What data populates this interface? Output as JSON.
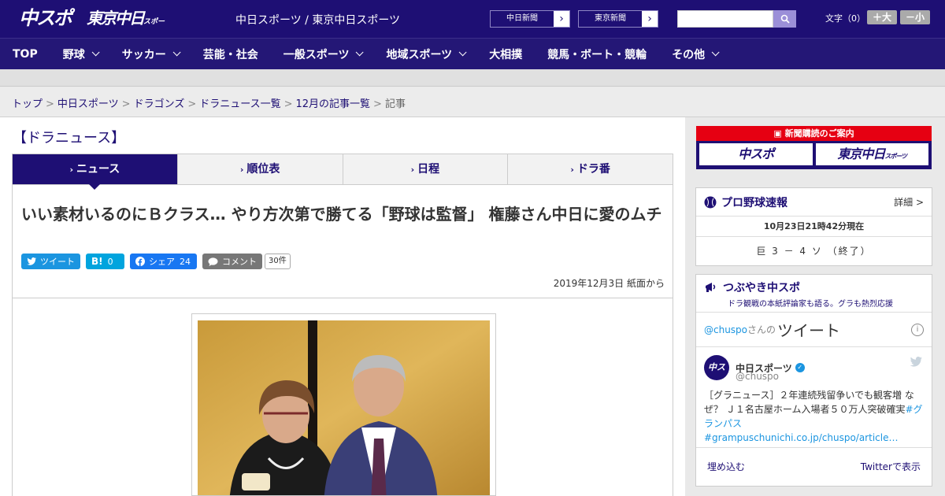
{
  "header": {
    "logo_chuspo": "中スポ",
    "logo_tokyo": "東京中日",
    "logo_tokyo_sub": "スポーツ",
    "site_title": "中日スポーツ / 東京中日スポーツ",
    "paper_buttons": [
      "中日新聞",
      "東京新聞"
    ],
    "search_placeholder": "",
    "font_size_label": "文字（0）",
    "font_large": "＋大",
    "font_small": "－小"
  },
  "nav": {
    "items": [
      {
        "label": "TOP",
        "caret": false
      },
      {
        "label": "野球",
        "caret": true
      },
      {
        "label": "サッカー",
        "caret": true
      },
      {
        "label": "芸能・社会",
        "caret": false
      },
      {
        "label": "一般スポーツ",
        "caret": true
      },
      {
        "label": "地域スポーツ",
        "caret": true
      },
      {
        "label": "大相撲",
        "caret": false
      },
      {
        "label": "競馬・ボート・競輪",
        "caret": false
      },
      {
        "label": "その他",
        "caret": true
      }
    ]
  },
  "breadcrumb": {
    "links": [
      "トップ",
      "中日スポーツ",
      "ドラゴンズ",
      "ドラニュース一覧",
      "12月の記事一覧"
    ],
    "current": "記事",
    "separator": ">"
  },
  "section": {
    "title": "【ドラニュース】"
  },
  "tabs": [
    {
      "label": "ニュース",
      "active": true
    },
    {
      "label": "順位表",
      "active": false
    },
    {
      "label": "日程",
      "active": false
    },
    {
      "label": "ドラ番",
      "active": false
    }
  ],
  "tab_arrow": "›",
  "article": {
    "headline": "いい素材いるのにＢクラス… やり方次第で勝てる「野球は監督」 権藤さん中日に愛のムチ",
    "share": {
      "tweet": "ツイート",
      "hatena_label": "B!",
      "hatena_count": "0",
      "facebook": "シェア",
      "facebook_count": "24",
      "comment": "コメント",
      "comment_count": "30件"
    },
    "dateline": "2019年12月3日 紙面から"
  },
  "sidebar": {
    "ad": {
      "header": "新聞購読のご案内",
      "logos": [
        "中スポ",
        "東京中日"
      ],
      "logo_sub": "スポーツ"
    },
    "score": {
      "title": "プロ野球速報",
      "detail": "詳細 >",
      "timestamp": "10月23日21時42分現在",
      "line": "巨 3 － 4 ソ （終了）"
    },
    "tweets": {
      "title": "つぶやき中スポ",
      "subtitle": "ドラ観戦の本紙評論家も語る。グラも熱烈応援",
      "handle": "@chuspo",
      "handle_suffix": "さんの",
      "word": "ツイート",
      "info": "i",
      "user_name": "中日スポーツ",
      "avatar_text": "中スポ",
      "verified": "✓",
      "user_at": "@chuspo",
      "text_plain": "［グラニュース］２年連続残留争いでも観客増 なぜ？ Ｊ１名古屋ホーム入場者５０万人突破確実",
      "text_link": "#グランパス #grampuschunichi.co.jp/chuspo/article…",
      "embed": "埋め込む",
      "view_on_twitter": "Twitterで表示"
    }
  },
  "colors": {
    "brand_navy": "#1e0f74",
    "accent_red": "#e60012",
    "twitter_blue": "#1b95e0"
  }
}
